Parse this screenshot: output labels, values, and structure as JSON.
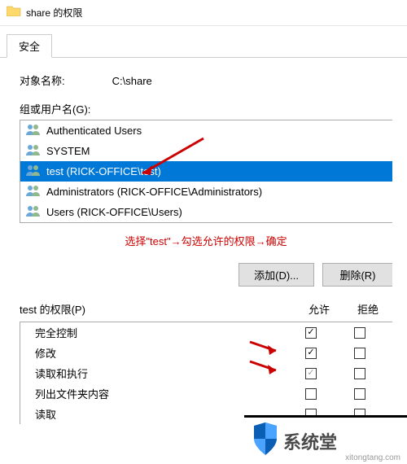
{
  "window": {
    "title": "share 的权限"
  },
  "tab": {
    "label": "安全"
  },
  "object": {
    "label": "对象名称:",
    "path": "C:\\share"
  },
  "group_label": "组或用户名(G):",
  "users": [
    {
      "label": "Authenticated Users",
      "selected": false
    },
    {
      "label": "SYSTEM",
      "selected": false
    },
    {
      "label": "test (RICK-OFFICE\\test)",
      "selected": true
    },
    {
      "label": "Administrators (RICK-OFFICE\\Administrators)",
      "selected": false
    },
    {
      "label": "Users (RICK-OFFICE\\Users)",
      "selected": false
    }
  ],
  "red_note": "选择\"test\"→勾选允许的权限→确定",
  "buttons": {
    "add": "添加(D)...",
    "remove": "删除(R)"
  },
  "perm_header": {
    "label": "test 的权限(P)",
    "allow": "允许",
    "deny": "拒绝"
  },
  "permissions": [
    {
      "label": "完全控制",
      "allow": true,
      "allow_gray": false,
      "deny": false
    },
    {
      "label": "修改",
      "allow": true,
      "allow_gray": false,
      "deny": false
    },
    {
      "label": "读取和执行",
      "allow": true,
      "allow_gray": true,
      "deny": false
    },
    {
      "label": "列出文件夹内容",
      "allow": false,
      "allow_gray": false,
      "deny": false
    },
    {
      "label": "读取",
      "allow": false,
      "allow_gray": false,
      "deny": false
    }
  ],
  "watermark": {
    "text": "系统堂",
    "url": "xitongtang.com"
  }
}
